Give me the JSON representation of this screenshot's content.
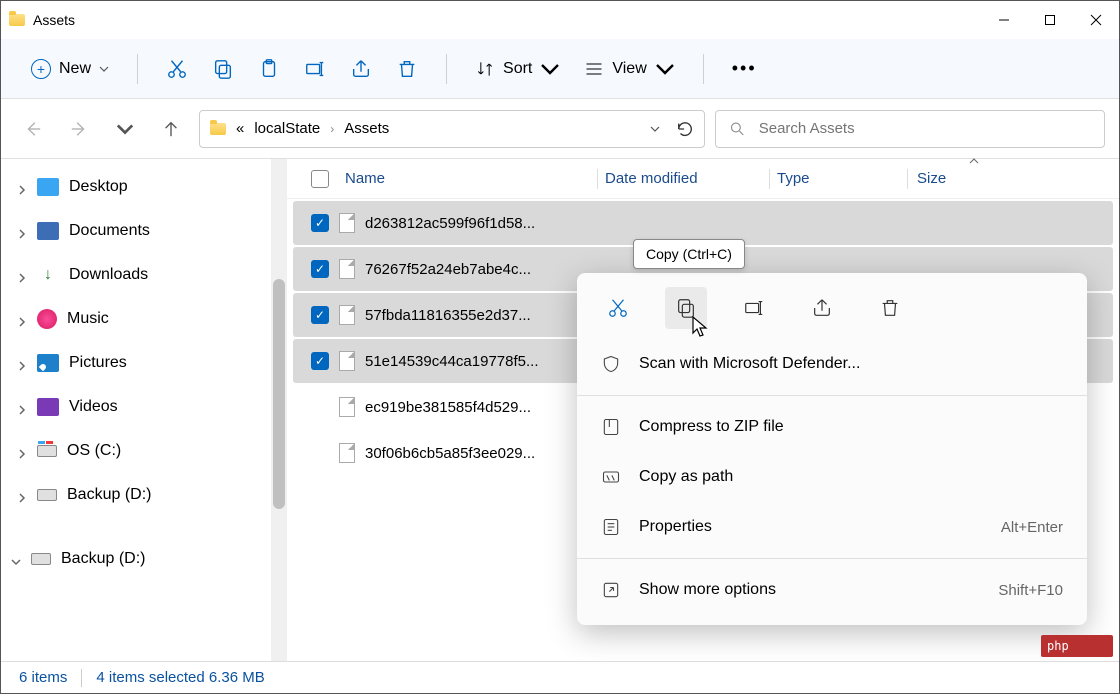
{
  "window": {
    "title": "Assets"
  },
  "toolbar": {
    "new_label": "New",
    "sort_label": "Sort",
    "view_label": "View"
  },
  "breadcrumb": {
    "first": "«",
    "parent": "localState",
    "current": "Assets"
  },
  "search": {
    "placeholder": "Search Assets"
  },
  "columns": {
    "name": "Name",
    "date": "Date modified",
    "type": "Type",
    "size": "Size"
  },
  "sidebar": {
    "items": [
      {
        "label": "Desktop",
        "icon": "blue",
        "expandable": true
      },
      {
        "label": "Documents",
        "icon": "doc",
        "expandable": true
      },
      {
        "label": "Downloads",
        "icon": "dl",
        "expandable": true
      },
      {
        "label": "Music",
        "icon": "music",
        "expandable": true
      },
      {
        "label": "Pictures",
        "icon": "pic",
        "expandable": true
      },
      {
        "label": "Videos",
        "icon": "vid",
        "expandable": true
      },
      {
        "label": "OS (C:)",
        "icon": "disk os",
        "expandable": true
      },
      {
        "label": "Backup (D:)",
        "icon": "disk",
        "expandable": true
      },
      {
        "label": "Backup (D:)",
        "icon": "disk",
        "expandable": true,
        "expanded": true
      }
    ]
  },
  "files": [
    {
      "name": "d263812ac599f96f1d58...",
      "selected": true
    },
    {
      "name": "76267f52a24eb7abe4c...",
      "selected": true
    },
    {
      "name": "57fbda11816355e2d37...",
      "selected": true
    },
    {
      "name": "51e14539c44ca19778f5...",
      "selected": true
    },
    {
      "name": "ec919be381585f4d529...",
      "selected": false
    },
    {
      "name": "30f06b6cb5a85f3ee029...",
      "selected": false
    }
  ],
  "tooltip": "Copy (Ctrl+C)",
  "context_menu": {
    "items": [
      {
        "label": "Scan with Microsoft Defender...",
        "icon": "shield"
      },
      {
        "label": "Compress to ZIP file",
        "icon": "zip"
      },
      {
        "label": "Copy as path",
        "icon": "path"
      },
      {
        "label": "Properties",
        "icon": "props",
        "shortcut": "Alt+Enter"
      },
      {
        "label": "Show more options",
        "icon": "more",
        "shortcut": "Shift+F10"
      }
    ]
  },
  "status": {
    "count": "6 items",
    "selection": "4 items selected  6.36 MB"
  },
  "badge": "php"
}
